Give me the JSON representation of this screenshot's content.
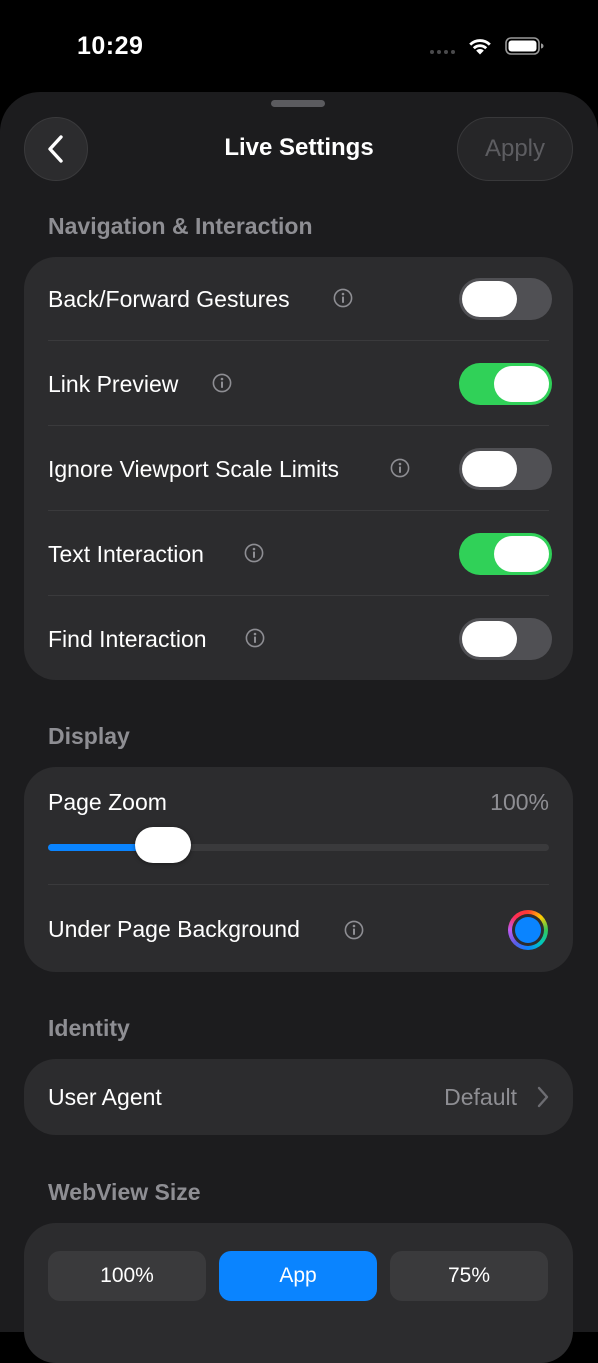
{
  "status_bar": {
    "time": "10:29"
  },
  "header": {
    "title": "Live Settings",
    "apply_label": "Apply"
  },
  "sections": {
    "navigation": {
      "title": "Navigation & Interaction",
      "rows": [
        {
          "label": "Back/Forward Gestures",
          "on": false
        },
        {
          "label": "Link Preview",
          "on": true
        },
        {
          "label": "Ignore Viewport Scale Limits",
          "on": false
        },
        {
          "label": "Text Interaction",
          "on": true
        },
        {
          "label": "Find Interaction",
          "on": false
        }
      ]
    },
    "display": {
      "title": "Display",
      "page_zoom_label": "Page Zoom",
      "page_zoom_value": "100%",
      "page_zoom_slider_fraction": 0.23,
      "under_page_background_label": "Under Page Background",
      "under_page_background_color": "#0a84ff"
    },
    "identity": {
      "title": "Identity",
      "user_agent_label": "User Agent",
      "user_agent_value": "Default"
    },
    "webview_size": {
      "title": "WebView Size",
      "options": [
        {
          "label": "100%",
          "active": false
        },
        {
          "label": "App",
          "active": true
        },
        {
          "label": "75%",
          "active": false
        }
      ]
    }
  },
  "colors": {
    "accent": "#0a84ff",
    "toggle_on": "#30d158",
    "toggle_off": "#505054",
    "background": "#1c1c1e",
    "card": "#2c2c2e"
  }
}
